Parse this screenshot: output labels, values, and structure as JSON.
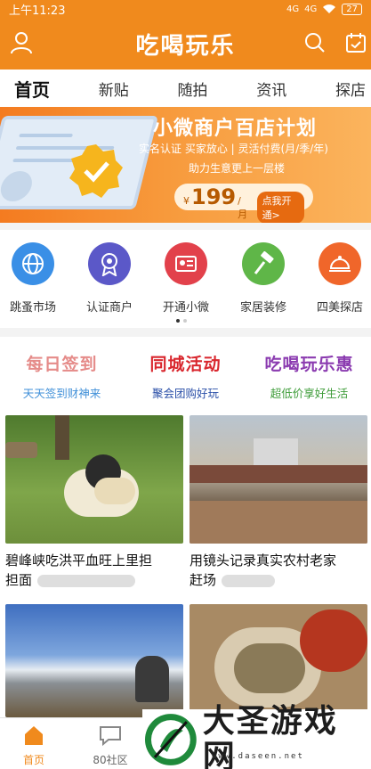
{
  "status_bar": {
    "time": "上午11:23",
    "signal_1": "4G",
    "signal_2": "4G",
    "battery": "27"
  },
  "header": {
    "title": "吃喝玩乐"
  },
  "tabs": [
    {
      "label": "首页",
      "active": true
    },
    {
      "label": "新贴"
    },
    {
      "label": "随拍"
    },
    {
      "label": "资讯"
    },
    {
      "label": "探店"
    }
  ],
  "banner": {
    "title": "小微商户百店计划",
    "subtitle": "实名认证 买家放心 | 灵活付费(月/季/年)",
    "subtitle2": "助力生意更上一层楼",
    "currency": "¥",
    "price": "199",
    "unit": "/月",
    "cta": "点我开通>"
  },
  "quick_icons": [
    {
      "label": "跳蚤市场",
      "color": "#3a8fe6",
      "icon": "globe-icon"
    },
    {
      "label": "认证商户",
      "color": "#5b58c8",
      "icon": "ribbon-badge-icon"
    },
    {
      "label": "开通小微",
      "color": "#e2414b",
      "icon": "id-card-icon"
    },
    {
      "label": "家居装修",
      "color": "#5fb648",
      "icon": "hammer-icon"
    },
    {
      "label": "四美探店",
      "color": "#f0662a",
      "icon": "dome-cover-icon"
    }
  ],
  "promo": [
    {
      "title": "每日签到",
      "sub": "天天签到财神来",
      "title_color": "#e58b89",
      "sub_color": "#3f8fd8"
    },
    {
      "title": "同城活动",
      "sub": "聚会团购好玩",
      "title_color": "#d9272e",
      "sub_color": "#2a4fa8"
    },
    {
      "title": "吃喝玩乐惠",
      "sub": "超低价享好生活",
      "title_color": "#8b3bb0",
      "sub_color": "#3e9c39"
    }
  ],
  "feed": [
    {
      "caption_line1": "碧峰峡吃洪平血旺上里担",
      "caption_line2": "担面"
    },
    {
      "caption_line1": "用镜头记录真实农村老家",
      "caption_line2": "赶场"
    },
    {
      "caption_line1": "",
      "caption_line2": ""
    },
    {
      "caption_line1": "",
      "caption_line2": ""
    }
  ],
  "bottom_nav": [
    {
      "label": "首页",
      "active": true
    },
    {
      "label": "80社区"
    }
  ],
  "watermark": {
    "text": "大圣游戏网",
    "url": "www.daseen.net"
  },
  "colors": {
    "brand": "#f08a1d"
  }
}
